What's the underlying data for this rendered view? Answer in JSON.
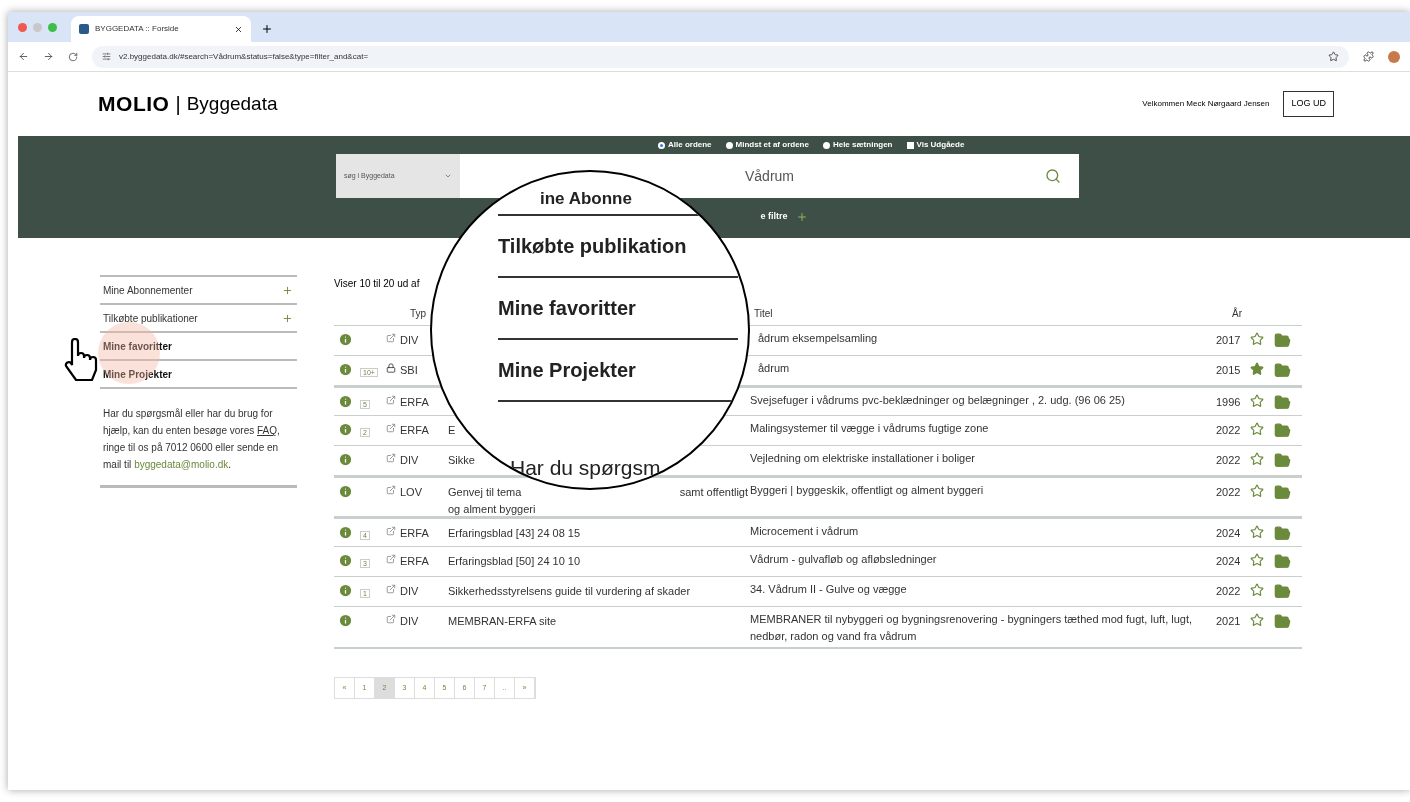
{
  "browser": {
    "tab_title": "BYGGEDATA :: Forside",
    "url": "v2.byggedata.dk/#search=Vådrum&status=false&type=filter_and&cat="
  },
  "header": {
    "logo_bold": "MOLIO",
    "logo_sep": "|",
    "logo_text": "Byggedata",
    "welcome": "Velkommen Meck Nørgaard Jensen",
    "logout": "LOG UD"
  },
  "search": {
    "options": [
      {
        "kind": "radio",
        "label": "Alle ordene",
        "selected": true
      },
      {
        "kind": "radio",
        "label": "Mindst et af ordene",
        "selected": false
      },
      {
        "kind": "radio",
        "label": "Hele sætningen",
        "selected": false
      },
      {
        "kind": "checkbox",
        "label": "Vis Udgåede",
        "selected": false
      }
    ],
    "scope": "søg i Byggedata",
    "query": "Vådrum",
    "more_filters": "e filtre"
  },
  "sidebar": {
    "items": [
      {
        "label": "Mine Abonnementer",
        "expandable": true
      },
      {
        "label": "Tilkøbte publikationer",
        "expandable": true
      },
      {
        "label": "Mine favoritter",
        "expandable": false
      },
      {
        "label": "Mine Projekter",
        "expandable": false
      }
    ],
    "help_before": "Har du spørgsmål eller har du brug for hjælp, kan du enten besøge vores",
    "faq": "FAQ",
    "help_middle": ", ringe til os på 7012 0600 eller sende en mail til",
    "email": "byggedata@molio.dk",
    "help_end": "."
  },
  "results": {
    "summary": "Viser 10 til 20 ud af",
    "columns": {
      "type": "Typ",
      "title": "Titel",
      "year": "År"
    },
    "rows": [
      {
        "badge": "",
        "kind": "link",
        "type": "DIV",
        "description": "",
        "title": "ådrum eksempelsamling",
        "year": "2017",
        "favorite": false
      },
      {
        "badge": "10+",
        "kind": "lock",
        "type": "SBI",
        "description": "",
        "title": "ådrum",
        "year": "2015",
        "favorite": true
      },
      {
        "badge": "5",
        "kind": "link",
        "type": "ERFA",
        "description": "",
        "title": "Svejsefuger i vådrums pvc-beklædninger og belægninger , 2. udg. (96 06 25)",
        "year": "1996",
        "favorite": false
      },
      {
        "badge": "2",
        "kind": "link",
        "type": "ERFA",
        "description": "E",
        "title": "Malingsystemer til vægge i vådrums fugtige zone",
        "year": "2022",
        "favorite": false
      },
      {
        "badge": "",
        "kind": "link",
        "type": "DIV",
        "description": "Sikke",
        "title": "Vejledning om elektriske installationer i boliger",
        "year": "2022",
        "favorite": false
      },
      {
        "badge": "",
        "kind": "link",
        "type": "LOV",
        "description": "Genvej til tema",
        "description_tail": "samt offentligt",
        "description_line2": "og alment byggeri",
        "title": "Byggeri | byggeskik, offentligt og alment byggeri",
        "year": "2022",
        "favorite": false
      },
      {
        "badge": "4",
        "kind": "link",
        "type": "ERFA",
        "description": "Erfaringsblad [43] 24 08 15",
        "title": "Microcement i vådrum",
        "year": "2024",
        "favorite": false
      },
      {
        "badge": "3",
        "kind": "link",
        "type": "ERFA",
        "description": "Erfaringsblad [50] 24 10 10",
        "title": "Vådrum - gulvafløb og afløbsledninger",
        "year": "2024",
        "favorite": false
      },
      {
        "badge": "1",
        "kind": "link",
        "type": "DIV",
        "description": "Sikkerhedsstyrelsens guide til vurdering af skader",
        "title": "34. Vådrum II - Gulve og vægge",
        "year": "2022",
        "favorite": false
      },
      {
        "badge": "",
        "kind": "link",
        "type": "DIV",
        "description": "MEMBRAN-ERFA site",
        "title": "MEMBRANER til nybyggeri og bygningsrenovering - bygningers tæthed mod fugt, luft, lugt, nedbør, radon og vand fra vådrum",
        "year": "2021",
        "favorite": false
      }
    ]
  },
  "pagination": [
    {
      "label": "«",
      "selected": false
    },
    {
      "label": "1",
      "selected": false
    },
    {
      "label": "2",
      "selected": true
    },
    {
      "label": "3",
      "selected": false
    },
    {
      "label": "4",
      "selected": false
    },
    {
      "label": "5",
      "selected": false
    },
    {
      "label": "6",
      "selected": false
    },
    {
      "label": "7",
      "selected": false
    },
    {
      "label": "..",
      "selected": false
    },
    {
      "label": "»",
      "selected": false
    }
  ],
  "magnifier": {
    "lines": [
      "ine Abonne",
      "Tilkøbte publikation",
      "Mine favoritter",
      "Mine Projekter",
      "Har du spørgsm"
    ]
  }
}
